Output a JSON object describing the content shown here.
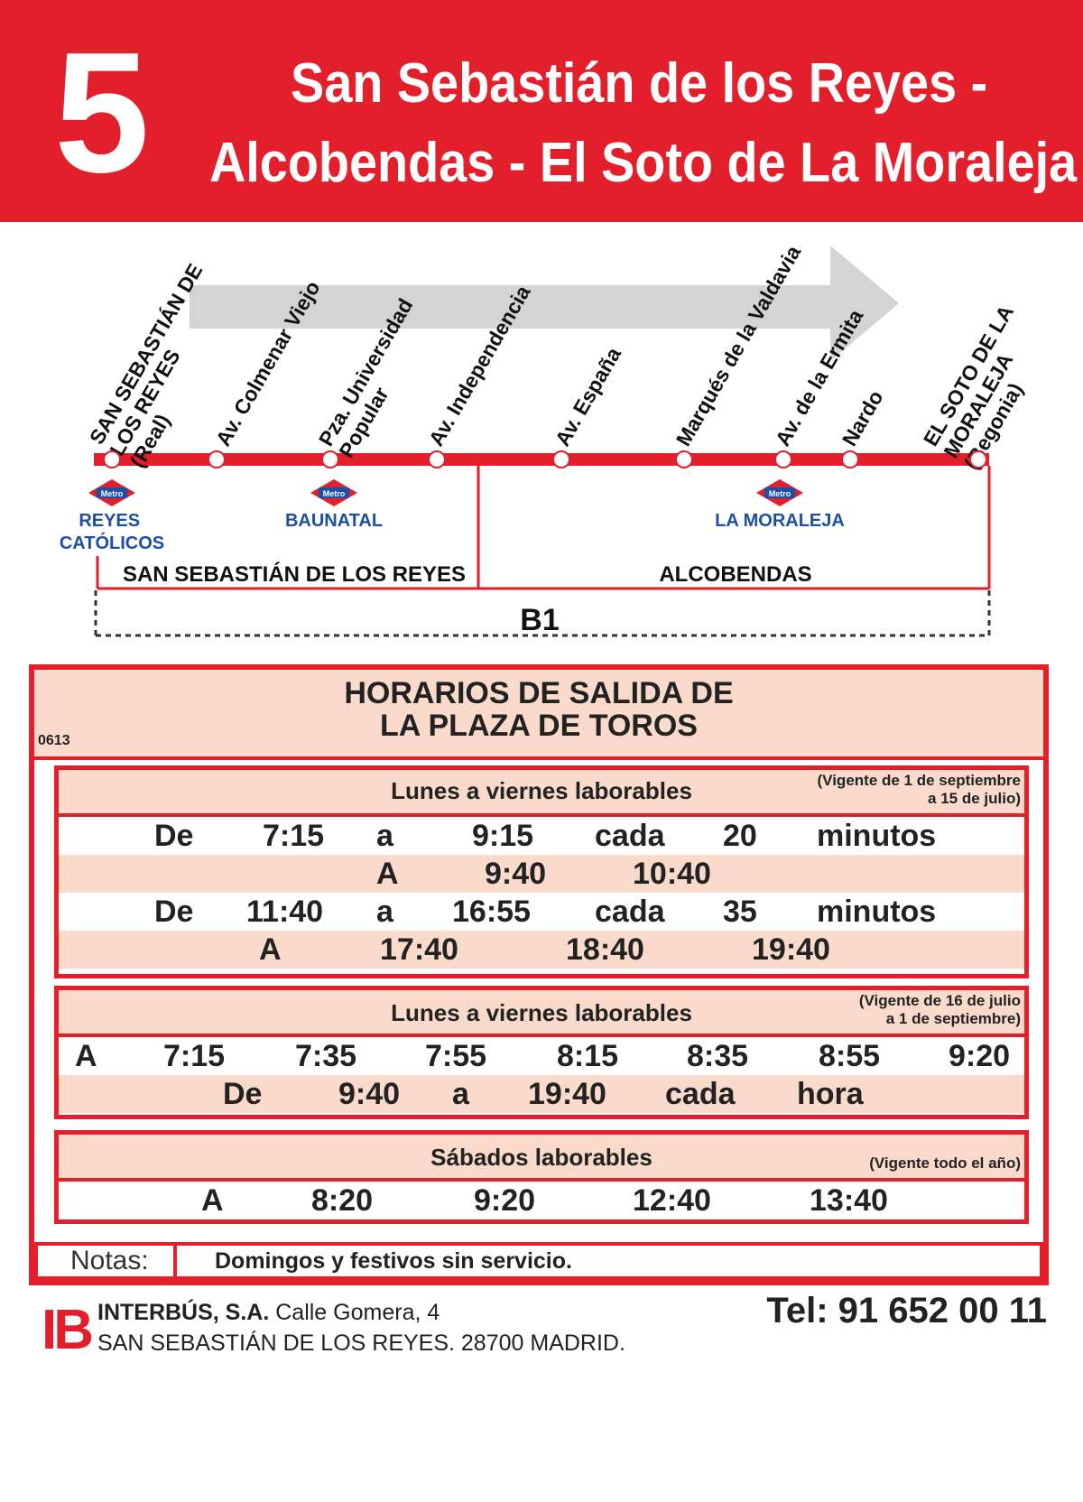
{
  "header": {
    "route_number": "5",
    "line1": "San Sebastián de los Reyes -",
    "line2": "Alcobendas - El Soto de La Moraleja",
    "color": "#e31f2b"
  },
  "route_map": {
    "stops": [
      {
        "lines": [
          "SAN SEBASTIÁN DE",
          "LOS REYES",
          "(Real)"
        ]
      },
      {
        "lines": [
          "Av. Colmenar Viejo"
        ]
      },
      {
        "lines": [
          "Pza. Universidad",
          "Popular"
        ]
      },
      {
        "lines": [
          "Av. Independencia"
        ]
      },
      {
        "lines": [
          "Av. España"
        ]
      },
      {
        "lines": [
          "Marqués de la Valdavia"
        ]
      },
      {
        "lines": [
          "Av. de la Ermita"
        ]
      },
      {
        "lines": [
          "Nardo"
        ]
      },
      {
        "lines": [
          "EL SOTO DE LA",
          "MORALEJA",
          "(Begonia)"
        ]
      }
    ],
    "metro_badge": "Metro",
    "metro_stations": [
      {
        "lines": [
          "REYES",
          "CATÓLICOS"
        ]
      },
      {
        "lines": [
          "BAUNATAL"
        ]
      },
      {
        "lines": [
          "LA MORALEJA"
        ]
      }
    ],
    "zones": [
      "SAN SEBASTIÁN DE LOS REYES",
      "ALCOBENDAS"
    ],
    "fare_zone": "B1"
  },
  "schedule": {
    "code": "0613",
    "title_line1": "HORARIOS DE SALIDA DE",
    "title_line2": "LA PLAZA DE TOROS",
    "blocks": [
      {
        "title": "Lunes a viernes laborables",
        "validity": [
          "(Vigente de 1 de septiembre",
          "a 15 de julio)"
        ],
        "rows": [
          [
            "De",
            "7:15",
            "a",
            "9:15",
            "cada",
            "20",
            "minutos"
          ],
          [
            "A",
            "9:40",
            "10:40"
          ],
          [
            "De",
            "11:40",
            "a",
            "16:55",
            "cada",
            "35",
            "minutos"
          ],
          [
            "A",
            "17:40",
            "18:40",
            "19:40"
          ]
        ]
      },
      {
        "title": "Lunes a viernes laborables",
        "validity": [
          "(Vigente de 16 de julio",
          "a 1 de septiembre)"
        ],
        "rows": [
          [
            "A",
            "7:15",
            "7:35",
            "7:55",
            "8:15",
            "8:35",
            "8:55",
            "9:20"
          ],
          [
            "De",
            "9:40",
            "a",
            "19:40",
            "cada",
            "hora"
          ]
        ]
      },
      {
        "title": "Sábados laborables",
        "validity": [
          "(Vigente todo el año)"
        ],
        "rows": [
          [
            "A",
            "8:20",
            "9:20",
            "12:40",
            "13:40"
          ]
        ]
      }
    ],
    "notes_label": "Notas:",
    "notes_text": "Domingos y festivos sin servicio."
  },
  "footer": {
    "logo": "IB",
    "company": "INTERBÚS, S.A.",
    "street": " Calle Gomera, 4",
    "address": "SAN SEBASTIÁN DE LOS REYES. 28700 MADRID.",
    "phone": "Tel: 91 652 00 11"
  }
}
